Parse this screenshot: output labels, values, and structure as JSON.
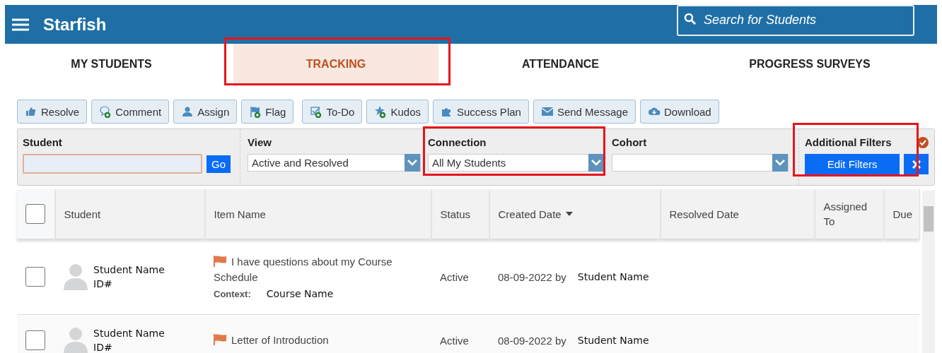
{
  "header": {
    "title": "Starfish",
    "search": {
      "placeholder": "Search for Students"
    }
  },
  "tabs": [
    {
      "label": "MY STUDENTS",
      "selected": false,
      "highlighted": false
    },
    {
      "label": "TRACKING",
      "selected": true,
      "highlighted": true
    },
    {
      "label": "ATTENDANCE",
      "selected": false,
      "highlighted": false
    },
    {
      "label": "PROGRESS SURVEYS",
      "selected": false,
      "highlighted": false
    }
  ],
  "toolbar": [
    "Resolve",
    "Comment",
    "Assign",
    "Flag",
    "To-Do",
    "Kudos",
    "Success Plan",
    "Send Message",
    "Download"
  ],
  "filters": {
    "student": {
      "label": "Student",
      "go": "Go"
    },
    "selects": [
      {
        "label": "View",
        "value": "Active and Resolved",
        "highlighted": false
      },
      {
        "label": "Connection",
        "value": "All My Students",
        "highlighted": true
      },
      {
        "label": "Cohort",
        "highlighted": false
      }
    ],
    "additional": {
      "label": "Additional Filters",
      "button": "Edit Filters",
      "highlighted": true
    }
  },
  "table": {
    "select_all_checked": false,
    "columns": [
      "Student",
      "Item Name",
      "Status",
      "Created Date",
      "Resolved Date",
      "Assigned To",
      "Due"
    ],
    "rows": [
      {
        "checked": false,
        "student": "Student Name",
        "id": "ID#",
        "item": "I have questions about my Course Schedule",
        "context_label": "Context:",
        "context": "Course Name",
        "status": "Active",
        "created": "08-09-2022 by",
        "creator": "Student Name"
      },
      {
        "checked": false,
        "student": "Student Name",
        "id": "ID#",
        "item": "Letter of Introduction",
        "status": "Active",
        "created": "08-09-2022 by",
        "creator": "Student Name"
      }
    ]
  }
}
